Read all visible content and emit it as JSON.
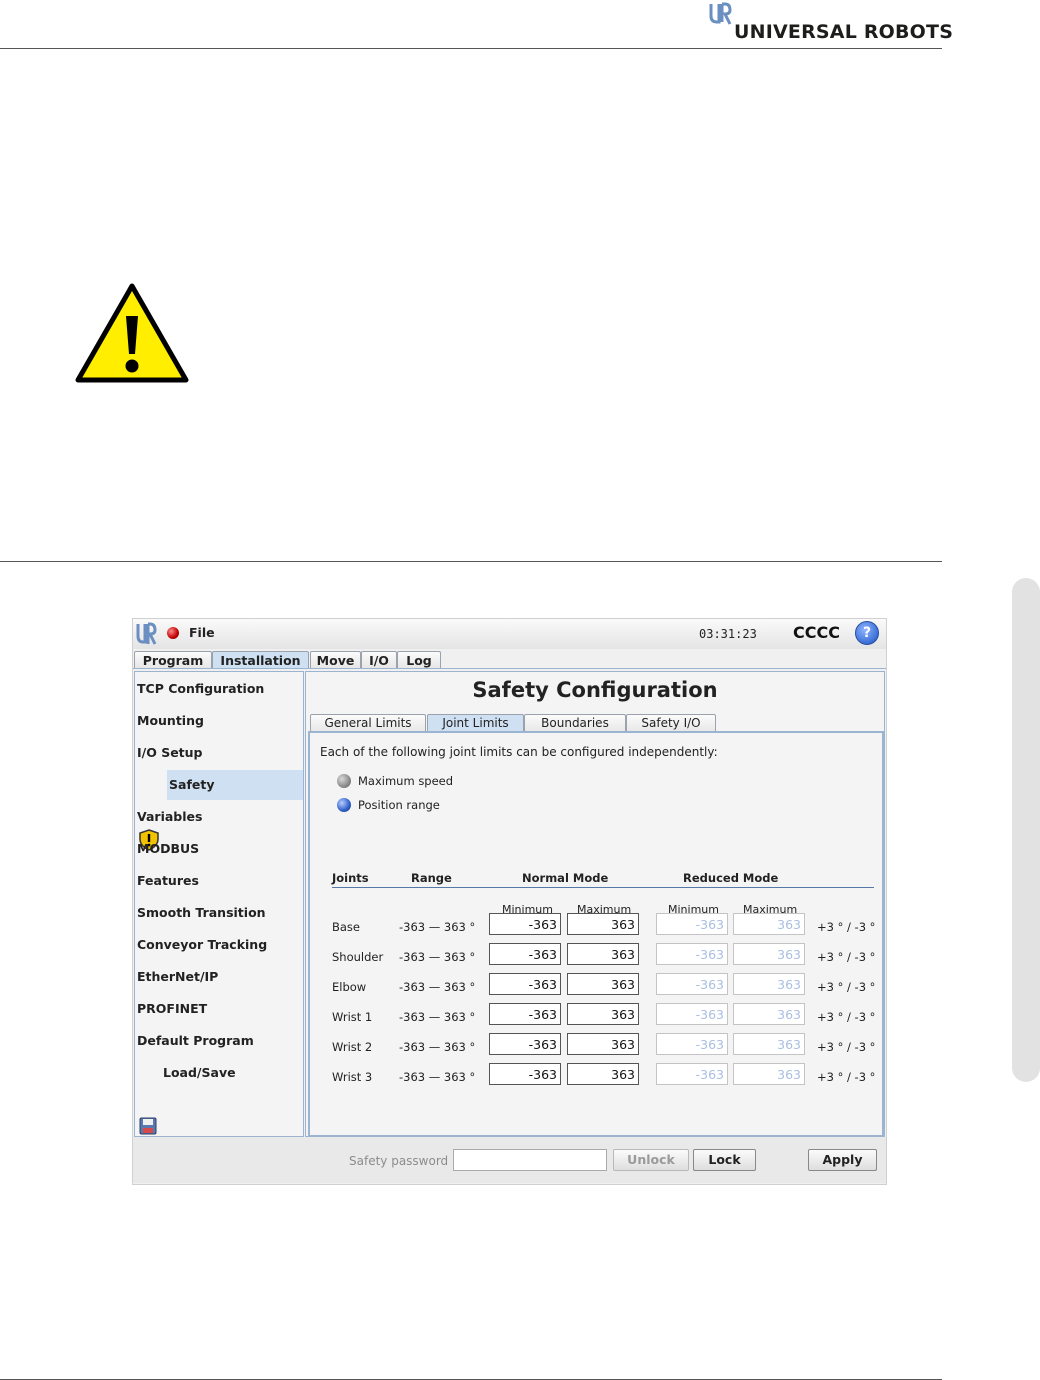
{
  "brand": {
    "name": "UNIVERSAL ROBOTS"
  },
  "titlebar": {
    "file": "File",
    "clock": "03:31:23",
    "robot_name": "CCCC",
    "help": "?"
  },
  "main_tabs": [
    "Program",
    "Installation",
    "Move",
    "I/O",
    "Log"
  ],
  "main_tab_active": "Installation",
  "sidebar": {
    "items": [
      "TCP Configuration",
      "Mounting",
      "I/O Setup",
      "Safety",
      "Variables",
      "MODBUS",
      "Features",
      "Smooth Transition",
      "Conveyor Tracking",
      "EtherNet/IP",
      "PROFINET",
      "Default Program",
      "Load/Save"
    ],
    "selected": "Safety"
  },
  "content": {
    "title": "Safety Configuration",
    "sub_tabs": [
      "General Limits",
      "Joint Limits",
      "Boundaries",
      "Safety I/O"
    ],
    "sub_tab_active": "Joint Limits",
    "intro": "Each of the following joint limits can be configured independently:",
    "options": [
      {
        "label": "Maximum speed",
        "selected": false
      },
      {
        "label": "Position range",
        "selected": true
      }
    ],
    "table": {
      "headers": {
        "joints": "Joints",
        "range": "Range",
        "normal": "Normal Mode",
        "reduced": "Reduced Mode"
      },
      "subheaders": {
        "min": "Minimum",
        "max": "Maximum"
      },
      "rows": [
        {
          "joint": "Base",
          "range": "-363 — 363 °",
          "normal_min": "-363",
          "normal_max": "363",
          "reduced_min": "-363",
          "reduced_max": "363",
          "tolerance": "+3 ° / -3 °"
        },
        {
          "joint": "Shoulder",
          "range": "-363 — 363 °",
          "normal_min": "-363",
          "normal_max": "363",
          "reduced_min": "-363",
          "reduced_max": "363",
          "tolerance": "+3 ° / -3 °"
        },
        {
          "joint": "Elbow",
          "range": "-363 — 363 °",
          "normal_min": "-363",
          "normal_max": "363",
          "reduced_min": "-363",
          "reduced_max": "363",
          "tolerance": "+3 ° / -3 °"
        },
        {
          "joint": "Wrist 1",
          "range": "-363 — 363 °",
          "normal_min": "-363",
          "normal_max": "363",
          "reduced_min": "-363",
          "reduced_max": "363",
          "tolerance": "+3 ° / -3 °"
        },
        {
          "joint": "Wrist 2",
          "range": "-363 — 363 °",
          "normal_min": "-363",
          "normal_max": "363",
          "reduced_min": "-363",
          "reduced_max": "363",
          "tolerance": "+3 ° / -3 °"
        },
        {
          "joint": "Wrist 3",
          "range": "-363 — 363 °",
          "normal_min": "-363",
          "normal_max": "363",
          "reduced_min": "-363",
          "reduced_max": "363",
          "tolerance": "+3 ° / -3 °"
        }
      ]
    }
  },
  "bottom": {
    "password_label": "Safety password",
    "password_value": "",
    "unlock": "Unlock",
    "lock": "Lock",
    "apply": "Apply"
  },
  "colors": {
    "selection": "#cfe0f3",
    "panel_border": "#9ab4d2",
    "warning_yellow": "#ffee00"
  },
  "icons": {
    "warning": "warning-triangle-icon",
    "safety": "shield-warning-icon",
    "file_status": "led-red-icon",
    "load_save": "floppy-disk-icon"
  }
}
